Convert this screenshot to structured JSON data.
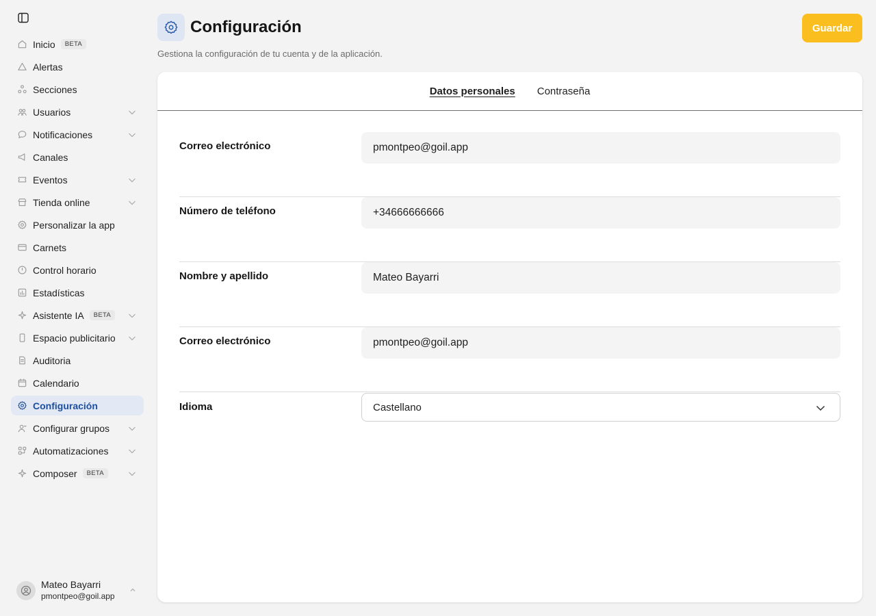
{
  "sidebar": {
    "items": [
      {
        "label": "Inicio",
        "icon": "home-icon",
        "badge": "BETA",
        "expandable": false,
        "active": false
      },
      {
        "label": "Alertas",
        "icon": "alert-triangle-icon",
        "badge": null,
        "expandable": false,
        "active": false
      },
      {
        "label": "Secciones",
        "icon": "sections-icon",
        "badge": null,
        "expandable": false,
        "active": false
      },
      {
        "label": "Usuarios",
        "icon": "users-icon",
        "badge": null,
        "expandable": true,
        "active": false
      },
      {
        "label": "Notificaciones",
        "icon": "chat-bubble-icon",
        "badge": null,
        "expandable": true,
        "active": false
      },
      {
        "label": "Canales",
        "icon": "megaphone-icon",
        "badge": null,
        "expandable": false,
        "active": false
      },
      {
        "label": "Eventos",
        "icon": "ticket-icon",
        "badge": null,
        "expandable": true,
        "active": false
      },
      {
        "label": "Tienda online",
        "icon": "store-icon",
        "badge": null,
        "expandable": true,
        "active": false
      },
      {
        "label": "Personalizar la app",
        "icon": "gear-icon",
        "badge": null,
        "expandable": false,
        "active": false
      },
      {
        "label": "Carnets",
        "icon": "card-icon",
        "badge": null,
        "expandable": false,
        "active": false
      },
      {
        "label": "Control horario",
        "icon": "clock-icon",
        "badge": null,
        "expandable": false,
        "active": false
      },
      {
        "label": "Estadísticas",
        "icon": "bar-chart-icon",
        "badge": null,
        "expandable": false,
        "active": false
      },
      {
        "label": "Asistente IA",
        "icon": "sparkle-icon",
        "badge": "BETA",
        "expandable": true,
        "active": false
      },
      {
        "label": "Espacio publicitario",
        "icon": "phone-icon",
        "badge": null,
        "expandable": true,
        "active": false
      },
      {
        "label": "Auditoria",
        "icon": "document-icon",
        "badge": null,
        "expandable": false,
        "active": false
      },
      {
        "label": "Calendario",
        "icon": "calendar-icon",
        "badge": null,
        "expandable": false,
        "active": false
      },
      {
        "label": "Configuración",
        "icon": "gear-icon",
        "badge": null,
        "expandable": false,
        "active": true
      },
      {
        "label": "Configurar grupos",
        "icon": "user-group-icon",
        "badge": null,
        "expandable": true,
        "active": false
      },
      {
        "label": "Automatizaciones",
        "icon": "workflow-icon",
        "badge": null,
        "expandable": true,
        "active": false
      },
      {
        "label": "Composer",
        "icon": "sparkle-icon",
        "badge": "BETA",
        "expandable": true,
        "active": false
      }
    ],
    "user": {
      "name": "Mateo Bayarri",
      "email": "pmontpeo@goil.app"
    }
  },
  "header": {
    "title": "Configuración",
    "subtitle": "Gestiona la configuración de tu cuenta y de la aplicación.",
    "save_label": "Guardar"
  },
  "tabs": [
    {
      "label": "Datos personales",
      "active": true
    },
    {
      "label": "Contraseña",
      "active": false
    }
  ],
  "form": {
    "email_label": "Correo electrónico",
    "email_value": "pmontpeo@goil.app",
    "phone_label": "Número de teléfono",
    "phone_value": "+34666666666",
    "name_label": "Nombre y apellido",
    "name_value": "Mateo Bayarri",
    "email2_label": "Correo electrónico",
    "email2_value": "pmontpeo@goil.app",
    "language_label": "Idioma",
    "language_value": "Castellano"
  },
  "colors": {
    "accent": "#fbbe1f",
    "active_nav_bg": "#e2e8f4",
    "active_nav_text": "#1d4fa0",
    "background": "#f3f3f3"
  }
}
